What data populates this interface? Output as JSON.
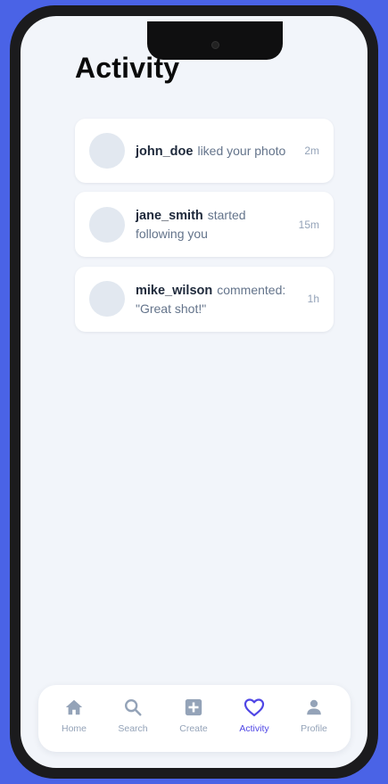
{
  "header": {
    "title": "Activity"
  },
  "notifications": [
    {
      "username": "john_doe",
      "action": "liked your photo",
      "time": "2m"
    },
    {
      "username": "jane_smith",
      "action": "started following you",
      "time": "15m"
    },
    {
      "username": "mike_wilson",
      "action": "commented: \"Great shot!\"",
      "time": "1h"
    }
  ],
  "nav": {
    "items": [
      {
        "label": "Home",
        "icon": "home-icon"
      },
      {
        "label": "Search",
        "icon": "search-icon"
      },
      {
        "label": "Create",
        "icon": "plus-square-icon"
      },
      {
        "label": "Activity",
        "icon": "heart-icon",
        "active": true
      },
      {
        "label": "Profile",
        "icon": "user-icon"
      }
    ]
  },
  "colors": {
    "background": "#4a63e6",
    "screen": "#f2f5fa",
    "accent": "#4f46e5",
    "muted": "#94a3b8"
  }
}
